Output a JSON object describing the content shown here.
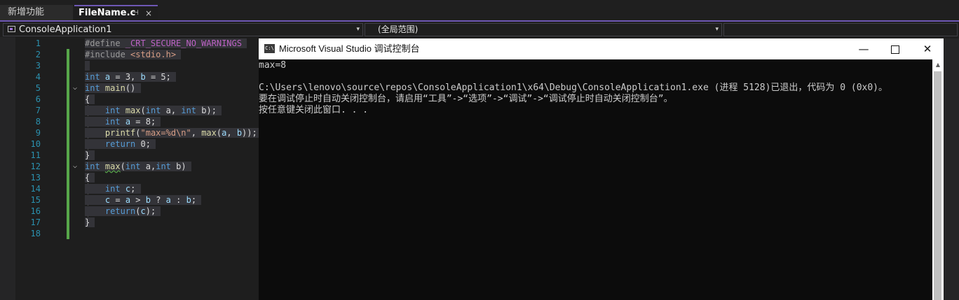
{
  "tabs": [
    {
      "label": "新增功能"
    },
    {
      "label": "FileName.c",
      "pin": "⊣",
      "close": "×"
    }
  ],
  "navbar": {
    "project": "ConsoleApplication1",
    "scope": "(全局范围)",
    "dropdown_arrow": "▾"
  },
  "editor": {
    "line_numbers": [
      "1",
      "2",
      "3",
      "4",
      "5",
      "6",
      "7",
      "8",
      "9",
      "10",
      "11",
      "12",
      "13",
      "14",
      "15",
      "16",
      "17",
      "18"
    ],
    "fold_glyph": "⌵"
  },
  "console": {
    "title": "Microsoft Visual Studio 调试控制台",
    "icon_label": "C:\\",
    "minimize": "—",
    "close": "✕",
    "lines": [
      "max=8",
      "",
      "C:\\Users\\lenovo\\source\\repos\\ConsoleApplication1\\x64\\Debug\\ConsoleApplication1.exe (进程 5128)已退出，代码为 0 (0x0)。",
      "要在调试停止时自动关闭控制台，请启用“工具”->“选项”->“调试”->“调试停止时自动关闭控制台”。",
      "按任意键关闭此窗口. . ."
    ],
    "scroll_up": "▲"
  },
  "colors": {
    "accent": "#6e57b4",
    "change_bar": "#57a64a",
    "keyword": "#569cd6",
    "line_number": "#2b91af"
  }
}
